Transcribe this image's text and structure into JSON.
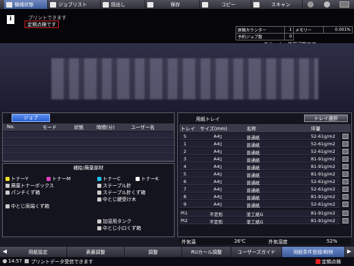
{
  "top_tabs": [
    {
      "label": "機械状態",
      "active": true
    },
    {
      "label": "ジョブリスト",
      "active": false
    },
    {
      "label": "読出し",
      "active": false
    },
    {
      "label": "保存",
      "active": false
    },
    {
      "label": "コピー",
      "active": false
    },
    {
      "label": "スキャン",
      "active": false
    }
  ],
  "messages": {
    "line1": "プリントできます",
    "line2": "定期点検です"
  },
  "counter": {
    "original_label": "原稿カウンター",
    "original_value": "1",
    "memory_label": "メモリー",
    "memory_value": "0.001%",
    "reserved_label": "予約ジョブ数",
    "reserved_value": "0"
  },
  "scanner_status": "スキャナー使用可能です",
  "job": {
    "title": "ジョブ",
    "headers": [
      "No.",
      "モード",
      "状態",
      "時間(分)",
      "ユーザー名"
    ]
  },
  "supplies": {
    "title": "補給/廃棄部材",
    "items": [
      {
        "label": "トナーY",
        "color": "#f0e020"
      },
      {
        "label": "トナーM",
        "color": "#e040c0"
      },
      {
        "label": "トナーC",
        "color": "#20c0f0"
      },
      {
        "label": "トナーK",
        "color": "#ffffff"
      },
      {
        "label": "廃棄トナーボックス",
        "color": "#ffffff"
      },
      {
        "label": "ステープル針",
        "color": "#ffffff"
      },
      {
        "label": "パンチくず箱",
        "color": "#ffffff"
      },
      {
        "label": "ステープル針くず箱",
        "color": "#ffffff"
      },
      {
        "label": "中とじ鍵受け木",
        "color": "#ffffff"
      },
      {
        "label": "中とじ両端くず箱",
        "color": "#ffffff"
      },
      {
        "label": "加湿用タンク",
        "color": "#ffffff"
      },
      {
        "label": "中とじ小口くず箱",
        "color": "#ffffff"
      }
    ]
  },
  "tray": {
    "title": "用紙トレイ",
    "select_button": "トレイ選択",
    "headers": [
      "トレイ",
      "サイズ(mm)",
      "名称",
      "坪量"
    ],
    "rows": [
      {
        "tray": "S",
        "size": "A4▯",
        "name": "普通紙",
        "weight": "52-61g/m2"
      },
      {
        "tray": "1",
        "size": "A4▯",
        "name": "普通紙",
        "weight": "52-61g/m2"
      },
      {
        "tray": "2",
        "size": "A4▯",
        "name": "普通紙",
        "weight": "52-61g/m2"
      },
      {
        "tray": "3",
        "size": "A4▯",
        "name": "普通紙",
        "weight": "81-91g/m2"
      },
      {
        "tray": "4",
        "size": "A4▯",
        "name": "普通紙",
        "weight": "81-91g/m2"
      },
      {
        "tray": "5",
        "size": "A4▯",
        "name": "普通紙",
        "weight": "81-91g/m2"
      },
      {
        "tray": "6",
        "size": "A4▯",
        "name": "普通紙",
        "weight": "52-61g/m2"
      },
      {
        "tray": "7",
        "size": "A4▯",
        "name": "普通紙",
        "weight": "52-61g/m2"
      },
      {
        "tray": "8",
        "size": "A4▯",
        "name": "普通紙",
        "weight": "81-91g/m2"
      },
      {
        "tray": "9",
        "size": "A4▯",
        "name": "普通紙",
        "weight": "52-61g/m2"
      }
    ],
    "inserter_rows": [
      {
        "tray": "PI1",
        "size": "不定形",
        "name": "塗工紙G",
        "weight": "81-91g/m2"
      },
      {
        "tray": "PI2",
        "size": "不定形",
        "name": "塗工紙G",
        "weight": "81-91g/m2"
      }
    ]
  },
  "environment": {
    "outside_temp_label": "外気温",
    "outside_temp_value": "26℃",
    "outside_humidity_label": "外気湿度",
    "outside_humidity_value": "52%"
  },
  "bottom_tabs": [
    {
      "label": "用紙設定",
      "active": false
    },
    {
      "label": "表裏調整",
      "active": false
    },
    {
      "label": "調整",
      "active": false
    },
    {
      "label": "RUカール調整",
      "active": false
    },
    {
      "label": "ユーザーズガイド",
      "active": false
    },
    {
      "label": "用紙条件登録/削除",
      "active": true
    }
  ],
  "status_bar": {
    "time": "14:57",
    "message": "プリントデータ受信できます",
    "right_label": "定期点検"
  }
}
